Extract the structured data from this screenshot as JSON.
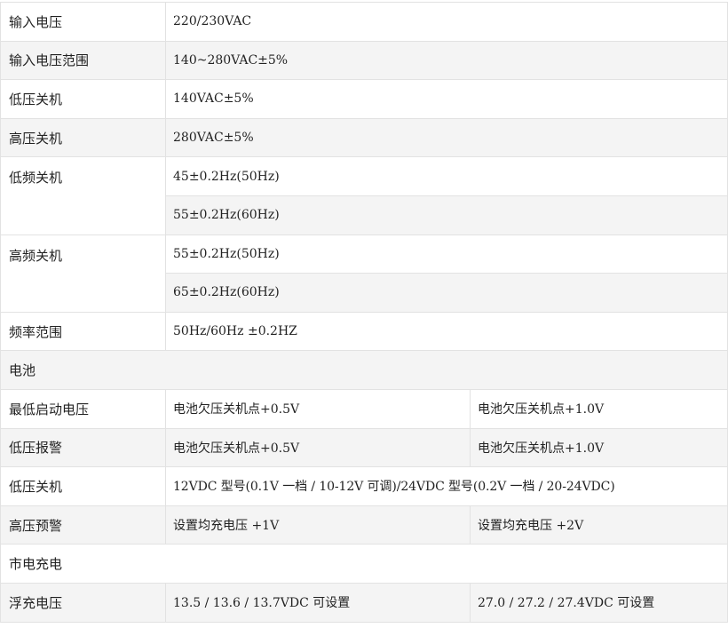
{
  "rows": {
    "input_voltage": {
      "label": "输入电压",
      "value": "220/230VAC"
    },
    "input_range": {
      "label": "输入电压范围",
      "value": "140~280VAC±5%"
    },
    "low_v_shutdown": {
      "label": "低压关机",
      "value": "140VAC±5%"
    },
    "high_v_shutdown": {
      "label": "高压关机",
      "value": "280VAC±5%"
    },
    "low_freq_shutdown": {
      "label": "低频关机",
      "values": [
        "45±0.2Hz(50Hz)",
        "55±0.2Hz(60Hz)"
      ]
    },
    "high_freq_shutdown": {
      "label": "高频关机",
      "values": [
        "55±0.2Hz(50Hz)",
        "65±0.2Hz(60Hz)"
      ]
    },
    "freq_range": {
      "label": "频率范围",
      "value": "50Hz/60Hz ±0.2HZ"
    }
  },
  "battery": {
    "section": "电池",
    "min_start_voltage": {
      "label": "最低启动电压",
      "col1": "电池欠压关机点+0.5V",
      "col2": "电池欠压关机点+1.0V"
    },
    "low_voltage_alarm": {
      "label": "低压报警",
      "col1": "电池欠压关机点+0.5V",
      "col2": "电池欠压关机点+1.0V"
    },
    "low_voltage_shutdown": {
      "label": "低压关机",
      "value": "12VDC 型号(0.1V 一档 / 10-12V 可调)/24VDC 型号(0.2V 一档 / 20-24VDC)"
    },
    "high_voltage_warning": {
      "label": "高压预警",
      "col1": "设置均充电压 +1V",
      "col2": "设置均充电压 +2V"
    }
  },
  "mains_charging": {
    "section": "市电充电",
    "float_voltage": {
      "label": "浮充电压",
      "col1": "13.5 / 13.6 / 13.7VDC 可设置",
      "col2": "27.0 / 27.2 / 27.4VDC 可设置"
    }
  }
}
